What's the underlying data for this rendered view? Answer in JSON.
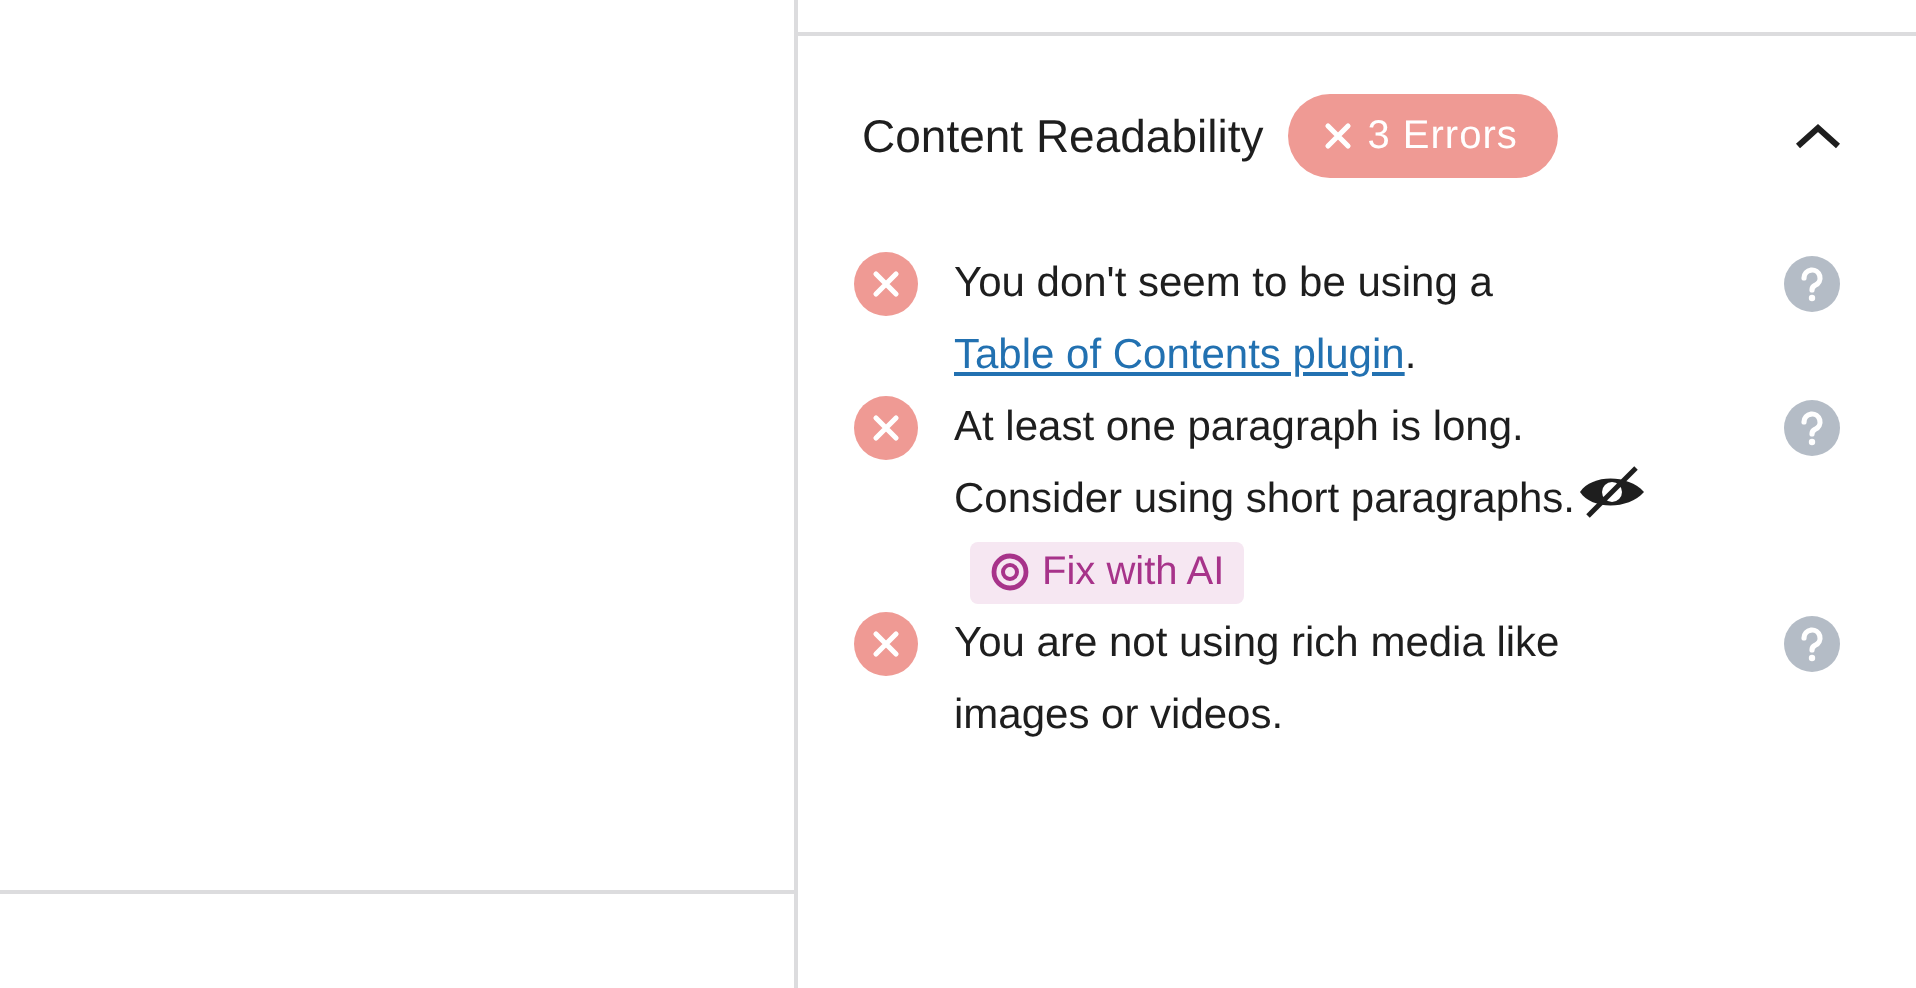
{
  "panel": {
    "title": "Content Readability",
    "badge": "3 Errors",
    "expanded": true
  },
  "checks": [
    {
      "failed": true,
      "parts": [
        {
          "kind": "text",
          "text": "You don't seem to be using a "
        },
        {
          "kind": "link",
          "text": "Table of Contents plugin"
        },
        {
          "kind": "text",
          "text": "."
        }
      ]
    },
    {
      "failed": true,
      "parts": [
        {
          "kind": "text",
          "text": "At least one paragraph is long. Consider using short paragraphs."
        }
      ],
      "action": "Fix with AI"
    },
    {
      "failed": true,
      "parts": [
        {
          "kind": "text",
          "text": "You are not using rich media like images or videos."
        }
      ]
    }
  ]
}
